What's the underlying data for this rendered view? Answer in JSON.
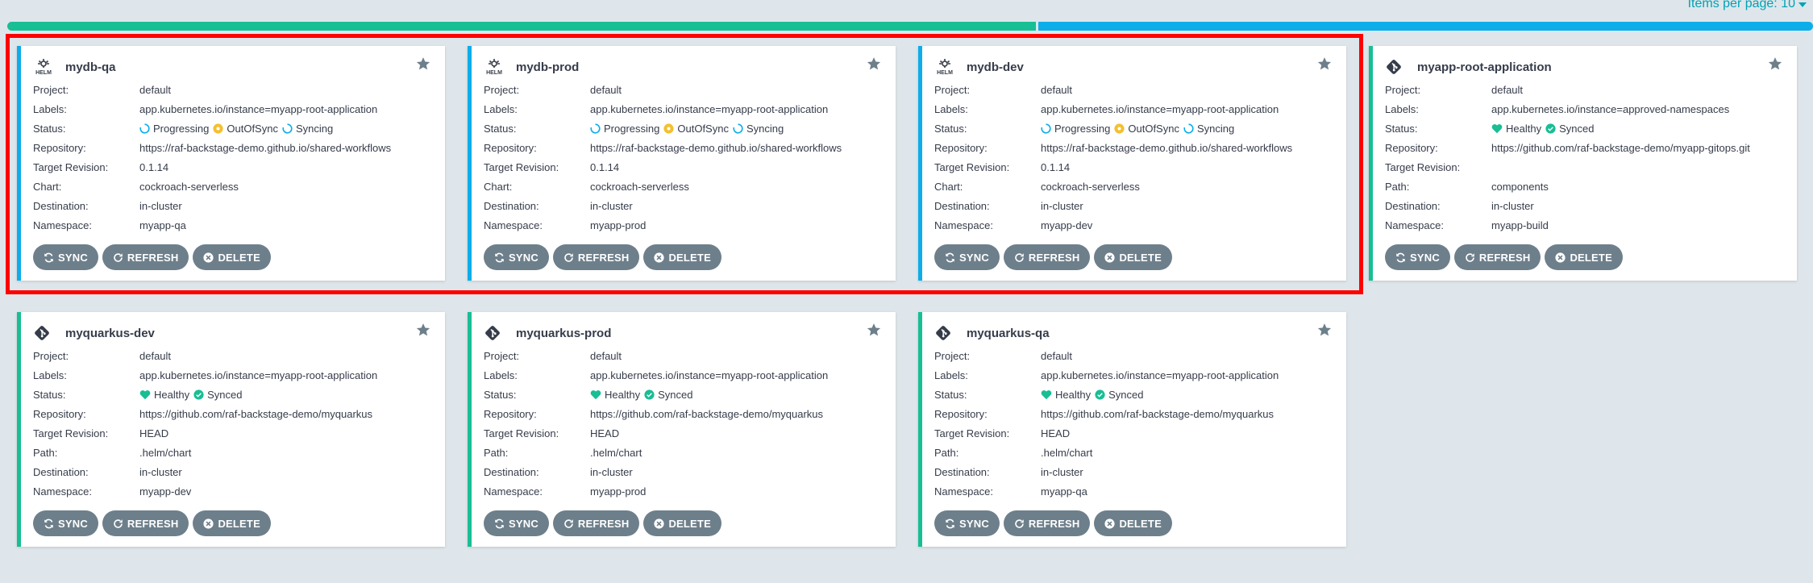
{
  "header": {
    "items_per_page_label": "Items per page: 10"
  },
  "status_bar": {
    "healthy_color": "#18be94",
    "progressing_color": "#0dadea"
  },
  "field_labels": {
    "project": "Project:",
    "labels": "Labels:",
    "status": "Status:",
    "repository": "Repository:",
    "target_revision": "Target Revision:",
    "chart": "Chart:",
    "path": "Path:",
    "destination": "Destination:",
    "namespace": "Namespace:"
  },
  "buttons": {
    "sync": "SYNC",
    "refresh": "REFRESH",
    "delete": "DELETE"
  },
  "apps": [
    {
      "name": "mydb-qa",
      "icon": "helm-icon",
      "health": "progressing",
      "project": "default",
      "labels": "app.kubernetes.io/instance=myapp-root-application",
      "status": [
        "Progressing",
        "OutOfSync",
        "Syncing"
      ],
      "repository": "https://raf-backstage-demo.github.io/shared-workflows",
      "target_revision": "0.1.14",
      "source_kind_label": "Chart:",
      "source_value": "cockroach-serverless",
      "destination": "in-cluster",
      "namespace": "myapp-qa"
    },
    {
      "name": "mydb-prod",
      "icon": "helm-icon",
      "health": "progressing",
      "project": "default",
      "labels": "app.kubernetes.io/instance=myapp-root-application",
      "status": [
        "Progressing",
        "OutOfSync",
        "Syncing"
      ],
      "repository": "https://raf-backstage-demo.github.io/shared-workflows",
      "target_revision": "0.1.14",
      "source_kind_label": "Chart:",
      "source_value": "cockroach-serverless",
      "destination": "in-cluster",
      "namespace": "myapp-prod"
    },
    {
      "name": "mydb-dev",
      "icon": "helm-icon",
      "health": "progressing",
      "project": "default",
      "labels": "app.kubernetes.io/instance=myapp-root-application",
      "status": [
        "Progressing",
        "OutOfSync",
        "Syncing"
      ],
      "repository": "https://raf-backstage-demo.github.io/shared-workflows",
      "target_revision": "0.1.14",
      "source_kind_label": "Chart:",
      "source_value": "cockroach-serverless",
      "destination": "in-cluster",
      "namespace": "myapp-dev"
    },
    {
      "name": "myapp-root-application",
      "icon": "git-icon",
      "health": "healthy",
      "project": "default",
      "labels": "app.kubernetes.io/instance=approved-namespaces",
      "status": [
        "Healthy",
        "Synced"
      ],
      "repository": "https://github.com/raf-backstage-demo/myapp-gitops.git",
      "target_revision": "",
      "source_kind_label": "Path:",
      "source_value": "components",
      "destination": "in-cluster",
      "namespace": "myapp-build"
    },
    {
      "name": "myquarkus-dev",
      "icon": "git-icon",
      "health": "healthy",
      "project": "default",
      "labels": "app.kubernetes.io/instance=myapp-root-application",
      "status": [
        "Healthy",
        "Synced"
      ],
      "repository": "https://github.com/raf-backstage-demo/myquarkus",
      "target_revision": "HEAD",
      "source_kind_label": "Path:",
      "source_value": ".helm/chart",
      "destination": "in-cluster",
      "namespace": "myapp-dev"
    },
    {
      "name": "myquarkus-prod",
      "icon": "git-icon",
      "health": "healthy",
      "project": "default",
      "labels": "app.kubernetes.io/instance=myapp-root-application",
      "status": [
        "Healthy",
        "Synced"
      ],
      "repository": "https://github.com/raf-backstage-demo/myquarkus",
      "target_revision": "HEAD",
      "source_kind_label": "Path:",
      "source_value": ".helm/chart",
      "destination": "in-cluster",
      "namespace": "myapp-prod"
    },
    {
      "name": "myquarkus-qa",
      "icon": "git-icon",
      "health": "healthy",
      "project": "default",
      "labels": "app.kubernetes.io/instance=myapp-root-application",
      "status": [
        "Healthy",
        "Synced"
      ],
      "repository": "https://github.com/raf-backstage-demo/myquarkus",
      "target_revision": "HEAD",
      "source_kind_label": "Path:",
      "source_value": ".helm/chart",
      "destination": "in-cluster",
      "namespace": "myapp-qa"
    }
  ]
}
